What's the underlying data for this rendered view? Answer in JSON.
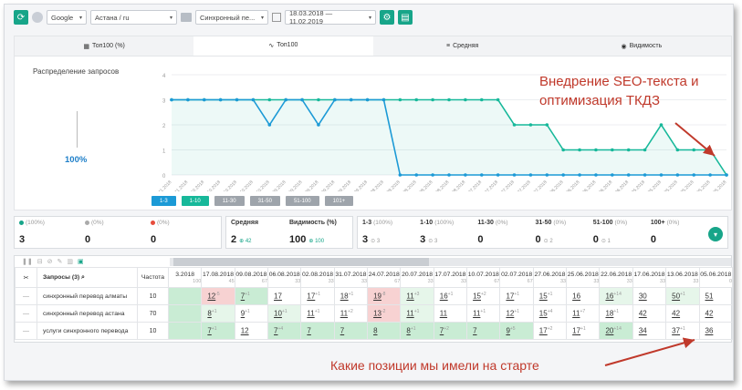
{
  "toolbar": {
    "engine": "Google",
    "region": "Астана / ru",
    "project": "Синхронный пе...",
    "date_range": "18.03.2018 — 11.02.2019"
  },
  "tabs": [
    {
      "label": "Топ100 (%)",
      "icon": "table-icon"
    },
    {
      "label": "Топ100",
      "icon": "line-chart-icon"
    },
    {
      "label": "Средняя",
      "icon": "list-icon"
    },
    {
      "label": "Видимость",
      "icon": "eye-icon"
    }
  ],
  "distribution": {
    "title": "Распределение запросов",
    "percent": "100%"
  },
  "chart_data": {
    "type": "line",
    "x": [
      "14.11.2018",
      "02.11.2018",
      "25.10.2018",
      "21.10.2018",
      "17.10.2018",
      "09.10.2018",
      "05.10.2018",
      "30.09.2018",
      "28.09.2018",
      "20.09.2018",
      "17.09.2018",
      "08.09.2018",
      "03.09.2018",
      "29.08.2018",
      "28.08.2018",
      "24.08.2018",
      "20.08.2018",
      "09.08.2018",
      "05.08.2018",
      "31.07.2018",
      "24.07.2018",
      "16.07.2018",
      "10.07.2018",
      "02.07.2018",
      "28.06.2018",
      "25.06.2018",
      "19.06.2018",
      "15.06.2018",
      "07.06.2018",
      "25.05.2018",
      "19.05.2018",
      "17.05.2018",
      "13.05.2018",
      "06.05.2018",
      "05.05.2018"
    ],
    "series": [
      {
        "color": "#1c9ad6",
        "values": [
          3,
          3,
          3,
          3,
          3,
          3,
          2,
          3,
          3,
          2,
          3,
          3,
          3,
          3,
          0,
          0,
          0,
          0,
          0,
          0,
          0,
          0,
          0,
          0,
          0,
          0,
          0,
          0,
          0,
          0,
          0,
          0,
          0,
          0,
          0
        ]
      },
      {
        "color": "#17b89a",
        "values": [
          3,
          3,
          3,
          3,
          3,
          3,
          3,
          3,
          3,
          3,
          3,
          3,
          3,
          3,
          3,
          3,
          3,
          3,
          3,
          3,
          3,
          2,
          2,
          2,
          1,
          1,
          1,
          1,
          1,
          1,
          2,
          1,
          1,
          1,
          0
        ]
      }
    ],
    "y_ticks": [
      "4",
      "3",
      "2",
      "1",
      "0"
    ],
    "ylim": [
      0,
      4
    ],
    "legend_buttons": [
      {
        "label": "1-3",
        "color": "#1c9ad6"
      },
      {
        "label": "1-10",
        "color": "#17b89a"
      },
      {
        "label": "11-30",
        "color": "#9ea4ab"
      },
      {
        "label": "31-50",
        "color": "#9ea4ab"
      },
      {
        "label": "51-100",
        "color": "#9ea4ab"
      },
      {
        "label": "101+",
        "color": "#9ea4ab"
      }
    ]
  },
  "annotations": {
    "top": "Внедрение SEO-текста и оптимизация ТКДЗ",
    "bottom": "Какие позиции мы имели на старте"
  },
  "stats": {
    "top100": {
      "label": "(100%)",
      "value": "3"
    },
    "zero1": {
      "label": "(0%)",
      "value": "0"
    },
    "zero2": {
      "label": "(0%)",
      "value": "0"
    },
    "avg": {
      "label": "Средняя",
      "value": "2",
      "delta": "42"
    },
    "visibility": {
      "label": "Видимость (%)",
      "value": "100",
      "delta": "100"
    },
    "r1_3": {
      "label": "1-3",
      "pct": "(100%)",
      "value": "3",
      "delta": "3"
    },
    "r1_10": {
      "label": "1-10",
      "pct": "(100%)",
      "value": "3",
      "delta": "3"
    },
    "r11_30": {
      "label": "11-30",
      "pct": "(0%)",
      "value": "0"
    },
    "r31_50": {
      "label": "31-50",
      "pct": "(0%)",
      "value": "0",
      "delta": "2"
    },
    "r51_100": {
      "label": "51-100",
      "pct": "(0%)",
      "value": "0",
      "delta": "1"
    },
    "r100p": {
      "label": "100+",
      "pct": "(0%)",
      "value": "0"
    }
  },
  "table": {
    "queries_header": "Запросы (3)",
    "freq_header": "Частота",
    "dates": [
      {
        "d": "3.2018",
        "s": "100"
      },
      {
        "d": "17.08.2018",
        "s": "45"
      },
      {
        "d": "09.08.2018",
        "s": "67"
      },
      {
        "d": "06.08.2018",
        "s": "33"
      },
      {
        "d": "02.08.2018",
        "s": "33"
      },
      {
        "d": "31.07.2018",
        "s": "33"
      },
      {
        "d": "24.07.2018",
        "s": "67"
      },
      {
        "d": "20.07.2018",
        "s": "33"
      },
      {
        "d": "17.07.2018",
        "s": "33"
      },
      {
        "d": "10.07.2018",
        "s": "67"
      },
      {
        "d": "02.07.2018",
        "s": "67"
      },
      {
        "d": "27.06.2018",
        "s": "33"
      },
      {
        "d": "25.06.2018",
        "s": "33"
      },
      {
        "d": "22.06.2018",
        "s": "33"
      },
      {
        "d": "17.06.2018",
        "s": "33"
      },
      {
        "d": "13.06.2018",
        "s": "33"
      },
      {
        "d": "05.06.2018",
        "s": "0"
      }
    ],
    "rows": [
      {
        "query": "синхронный перевод алматы",
        "freq": "10",
        "cells": [
          [
            "",
            "g"
          ],
          [
            "12",
            "r",
            "-5"
          ],
          [
            "7",
            "g",
            "+1"
          ],
          [
            "17",
            "",
            ""
          ],
          [
            "17",
            "",
            "+1"
          ],
          [
            "18",
            "",
            "+1"
          ],
          [
            "19",
            "r",
            "-8"
          ],
          [
            "11",
            "lg",
            "+3"
          ],
          [
            "16",
            "",
            "+1"
          ],
          [
            "15",
            "",
            "+2"
          ],
          [
            "17",
            "",
            "+1"
          ],
          [
            "15",
            "",
            "+1"
          ],
          [
            "16",
            "",
            ""
          ],
          [
            "16",
            "lg",
            "+14"
          ],
          [
            "30",
            "",
            ""
          ],
          [
            "50",
            "lg",
            "+1"
          ],
          [
            "51",
            "",
            ""
          ]
        ]
      },
      {
        "query": "синхронный перевод астана",
        "freq": "70",
        "cells": [
          [
            "",
            "g"
          ],
          [
            "8",
            "lg",
            "+1"
          ],
          [
            "9",
            "",
            "+1"
          ],
          [
            "10",
            "lg",
            "+1"
          ],
          [
            "11",
            "",
            "+1"
          ],
          [
            "11",
            "",
            "+2"
          ],
          [
            "13",
            "r",
            "-2"
          ],
          [
            "11",
            "lg",
            "+1"
          ],
          [
            "11",
            "",
            ""
          ],
          [
            "11",
            "",
            "+1"
          ],
          [
            "12",
            "",
            "+1"
          ],
          [
            "15",
            "",
            "+4"
          ],
          [
            "11",
            "",
            "+7"
          ],
          [
            "18",
            "",
            "+1"
          ],
          [
            "42",
            "",
            ""
          ],
          [
            "42",
            "",
            ""
          ],
          [
            "42",
            "",
            ""
          ]
        ]
      },
      {
        "query": "услуги синхронного перевода",
        "freq": "10",
        "cells": [
          [
            "",
            "g"
          ],
          [
            "7",
            "g",
            "+1"
          ],
          [
            "12",
            "",
            ""
          ],
          [
            "7",
            "g",
            "+4"
          ],
          [
            "7",
            "g",
            ""
          ],
          [
            "7",
            "g",
            ""
          ],
          [
            "8",
            "g",
            ""
          ],
          [
            "8",
            "g",
            "+1"
          ],
          [
            "7",
            "g",
            "+2"
          ],
          [
            "7",
            "g",
            ""
          ],
          [
            "9",
            "g",
            "+5"
          ],
          [
            "17",
            "",
            "+2"
          ],
          [
            "17",
            "",
            "+1"
          ],
          [
            "20",
            "g",
            "+14"
          ],
          [
            "34",
            "",
            ""
          ],
          [
            "37",
            "",
            "+1"
          ],
          [
            "36",
            "",
            ""
          ]
        ]
      }
    ]
  }
}
